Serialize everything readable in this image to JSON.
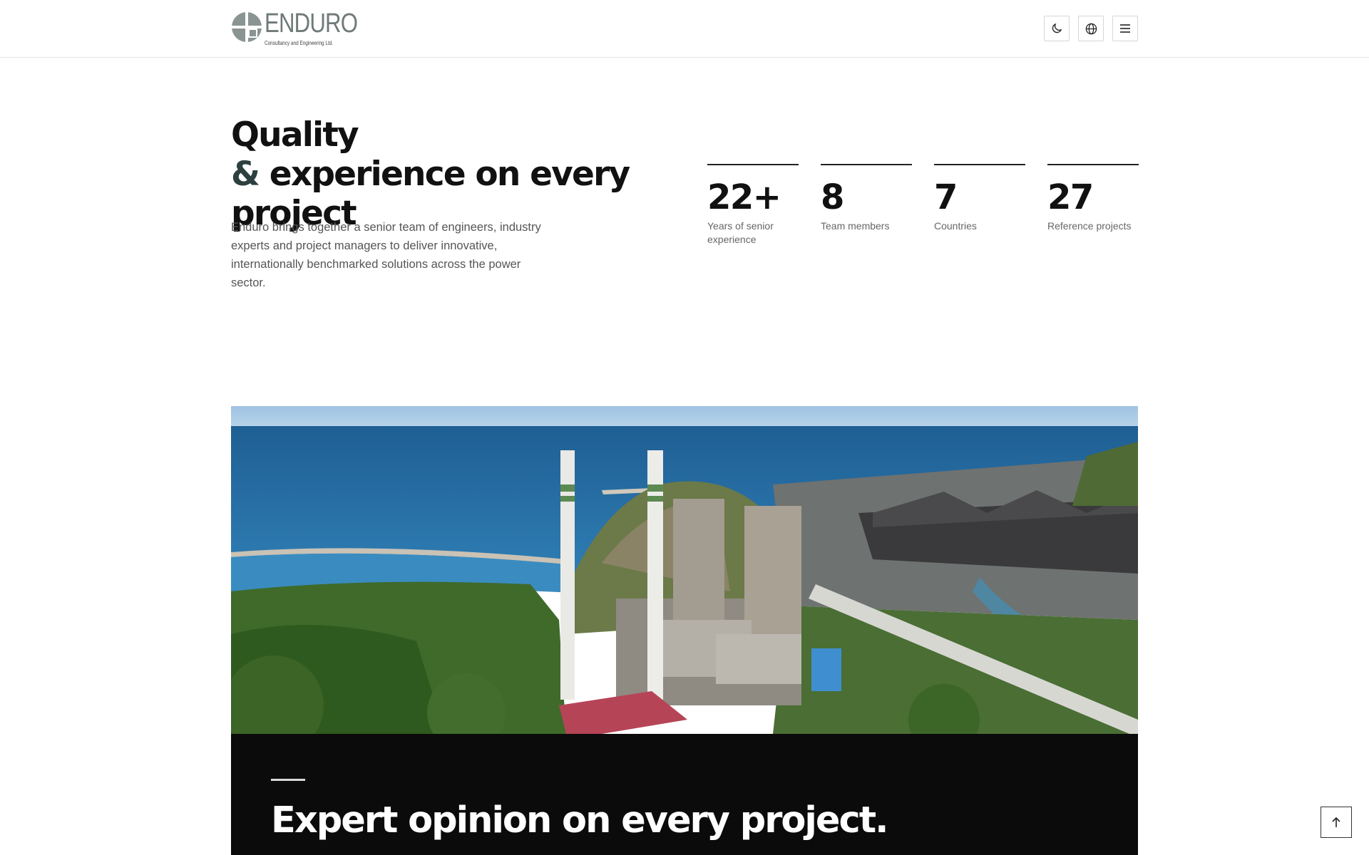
{
  "header": {
    "logo_word": "ENDURO",
    "logo_sub": "Consultancy and Engineering Ltd.",
    "buttons": [
      {
        "name": "theme-toggle-button",
        "icon": "moon-icon"
      },
      {
        "name": "language-button",
        "icon": "globe-icon"
      },
      {
        "name": "menu-button",
        "icon": "hamburger-menu-icon"
      }
    ]
  },
  "hero": {
    "title_line1": "Quality",
    "title_amp": "&",
    "title_line2": " experience on every project",
    "lead": "Enduro brings together a senior team of engineers, industry experts and project managers to deliver innovative, internationally benchmarked solutions across the power sector."
  },
  "stats": [
    {
      "value": "22+",
      "label": "Years of senior experience"
    },
    {
      "value": "8",
      "label": "Team members"
    },
    {
      "value": "7",
      "label": "Countries"
    },
    {
      "value": "27",
      "label": "Reference projects"
    }
  ],
  "feature": {
    "image_subject": "coastal-thermal-power-plant-photo",
    "title": "Expert opinion on every project."
  },
  "back_to_top": {
    "icon": "arrow-up-icon"
  },
  "colors": {
    "accent_dark": "#2d4040",
    "panel_bg": "#0b0b0b",
    "logo_gray": "#6f7a79"
  }
}
